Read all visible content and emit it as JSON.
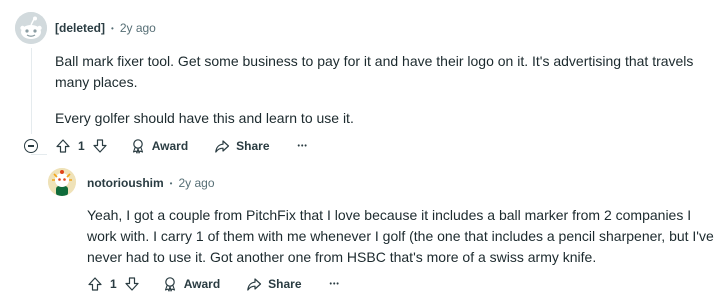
{
  "comment1": {
    "author": "[deleted]",
    "separator": "•",
    "time": "2y ago",
    "paragraphs": [
      "Ball mark fixer tool. Get some business to pay for it and have their logo on it. It's advertising that travels many places.",
      "Every golfer should have this and learn to use it."
    ],
    "votes": "1",
    "award_label": "Award",
    "share_label": "Share",
    "more_label": "•••"
  },
  "comment2": {
    "author": "notorioushim",
    "separator": "•",
    "time": "2y ago",
    "text": "Yeah, I got a couple from PitchFix that I love because it includes a ball marker from 2 companies I work with. I carry 1 of them with me whenever I golf (the one that includes a pencil sharpener, but I've never had to use it. Got another one from HSBC that's more of a swiss army knife.",
    "votes": "1",
    "award_label": "Award",
    "share_label": "Share",
    "more_label": "•••"
  },
  "colors": {
    "thread_line": "#e5ebee",
    "meta": "#576f76",
    "text": "#1c2a2e"
  }
}
